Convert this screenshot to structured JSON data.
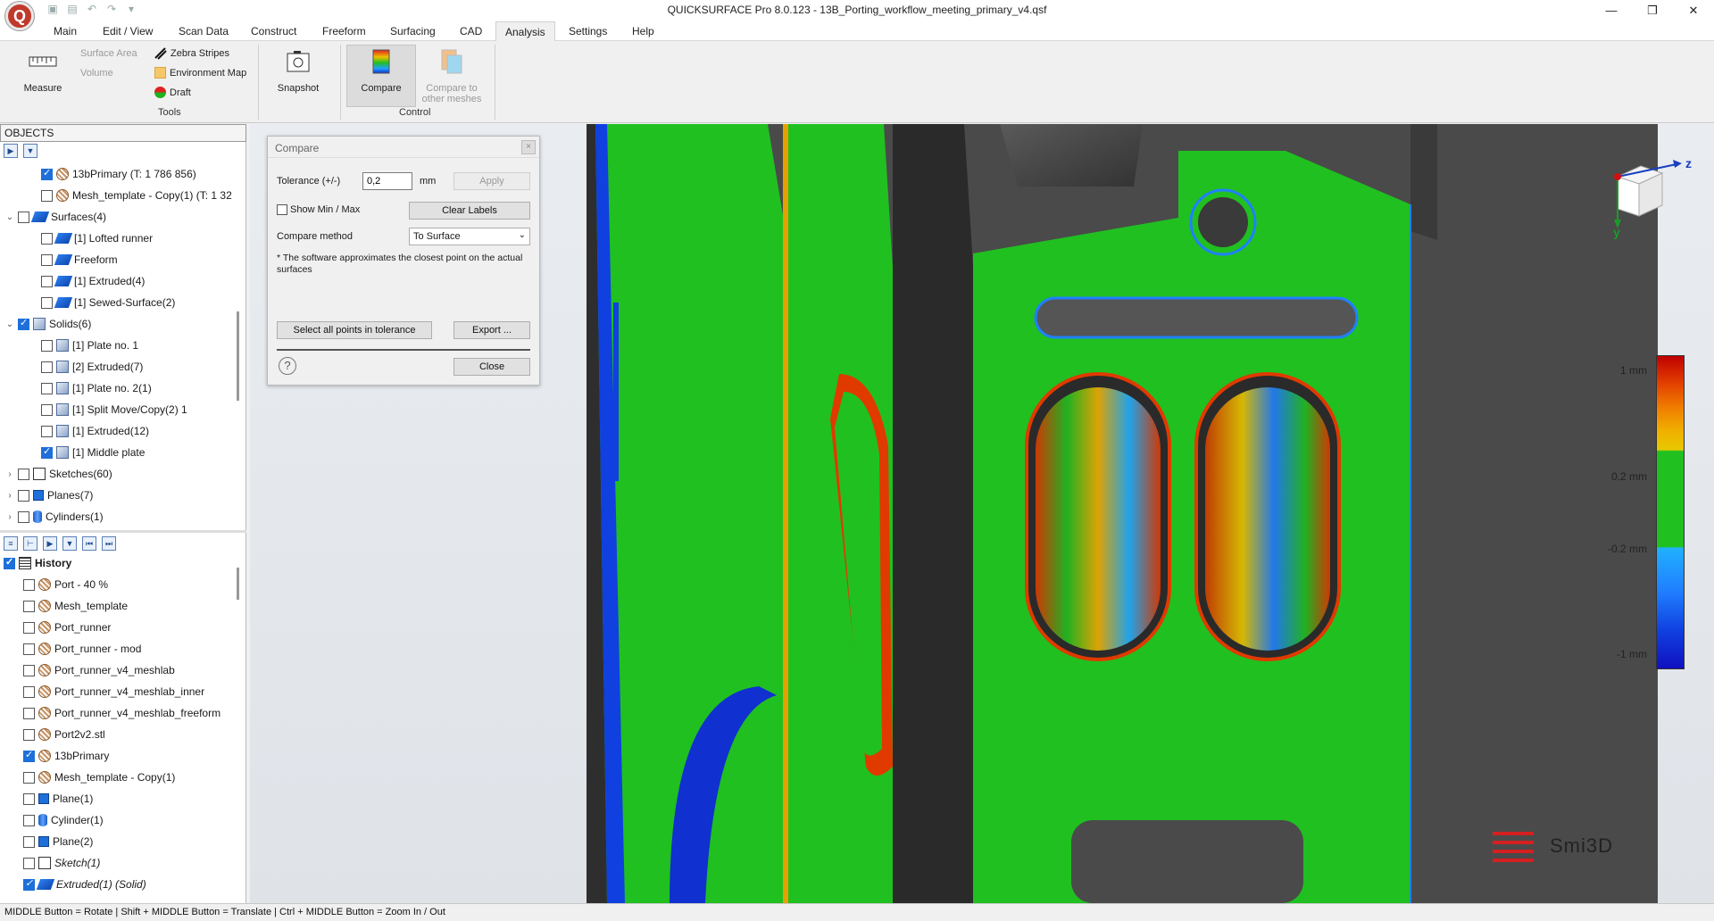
{
  "window": {
    "title": "QUICKSURFACE Pro 8.0.123 - 13B_Porting_workflow_meeting_primary_v4.qsf",
    "app_logo": "Q"
  },
  "menu": {
    "tabs": [
      "Main",
      "Edit / View",
      "Scan Data",
      "Construct",
      "Freeform",
      "Surfacing",
      "CAD",
      "Analysis",
      "Settings",
      "Help"
    ],
    "active": "Analysis"
  },
  "ribbon": {
    "measure": "Measure",
    "surface_area": "Surface Area",
    "volume": "Volume",
    "zebra": "Zebra Stripes",
    "env_map": "Environment Map",
    "draft": "Draft",
    "snapshot": "Snapshot",
    "compare": "Compare",
    "compare_other_1": "Compare to",
    "compare_other_2": "other meshes",
    "group_tools": "Tools",
    "group_control": "Control"
  },
  "objects": {
    "header": "OBJECTS",
    "rows": [
      {
        "label": "13bPrimary (T: 1 786 856)",
        "checked": true
      },
      {
        "label": "Mesh_template - Copy(1) (T: 1 32",
        "checked": false
      },
      {
        "label": "Surfaces(4)",
        "checked": false
      },
      {
        "label": "[1] Lofted runner",
        "checked": false
      },
      {
        "label": "Freeform",
        "checked": false
      },
      {
        "label": "[1] Extruded(4)",
        "checked": false
      },
      {
        "label": "[1] Sewed-Surface(2)",
        "checked": false
      },
      {
        "label": "Solids(6)",
        "checked": true
      },
      {
        "label": "[1] Plate no. 1",
        "checked": false
      },
      {
        "label": "[2] Extruded(7)",
        "checked": false
      },
      {
        "label": "[1] Plate no. 2(1)",
        "checked": false
      },
      {
        "label": "[1] Split Move/Copy(2) 1",
        "checked": false
      },
      {
        "label": "[1] Extruded(12)",
        "checked": false
      },
      {
        "label": "[1] Middle plate",
        "checked": true
      },
      {
        "label": "Sketches(60)",
        "checked": false
      },
      {
        "label": "Planes(7)",
        "checked": false
      },
      {
        "label": "Cylinders(1)",
        "checked": false
      }
    ]
  },
  "history": {
    "header": "History",
    "rows": [
      {
        "label": "Port - 40 %",
        "checked": false
      },
      {
        "label": "Mesh_template",
        "checked": false
      },
      {
        "label": "Port_runner",
        "checked": false
      },
      {
        "label": "Port_runner - mod",
        "checked": false
      },
      {
        "label": "Port_runner_v4_meshlab",
        "checked": false
      },
      {
        "label": "Port_runner_v4_meshlab_inner",
        "checked": false
      },
      {
        "label": "Port_runner_v4_meshlab_freeform",
        "checked": false
      },
      {
        "label": "Port2v2.stl",
        "checked": false
      },
      {
        "label": "13bPrimary",
        "checked": true
      },
      {
        "label": "Mesh_template - Copy(1)",
        "checked": false
      },
      {
        "label": "Plane(1)",
        "checked": false
      },
      {
        "label": "Cylinder(1)",
        "checked": false
      },
      {
        "label": "Plane(2)",
        "checked": false
      },
      {
        "label": "Sketch(1)",
        "checked": false
      },
      {
        "label": "Extruded(1) (Solid)",
        "checked": true
      }
    ]
  },
  "dialog": {
    "title": "Compare",
    "tolerance_label": "Tolerance (+/-)",
    "tolerance_value": "0,2",
    "unit": "mm",
    "apply": "Apply",
    "show_minmax": "Show Min / Max",
    "clear_labels": "Clear Labels",
    "method_label": "Compare method",
    "method_value": "To Surface",
    "note": "* The software approximates the closest point on the actual surfaces",
    "select_all": "Select all points in tolerance",
    "export": "Export ...",
    "close": "Close",
    "help": "?",
    "close_x": "×"
  },
  "legend": {
    "labels": [
      "1 mm",
      "0.2 mm",
      "-0.2 mm",
      "-1 mm"
    ]
  },
  "gizmo": {
    "z": "z",
    "y": "y"
  },
  "brand": {
    "name": "Smi3D"
  },
  "status": "MIDDLE Button = Rotate | Shift + MIDDLE Button = Translate | Ctrl + MIDDLE Button = Zoom In / Out",
  "colors": {
    "in_tolerance": "#20c020",
    "above": "#e03a00",
    "below": "#1040e0",
    "accent": "#1e6fd9"
  }
}
